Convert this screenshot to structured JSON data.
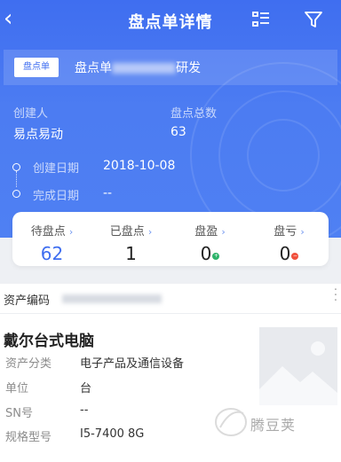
{
  "nav": {
    "back_icon": "‹",
    "title": "盘点单详情"
  },
  "order": {
    "tag": "盘点单",
    "name_prefix": "盘点单",
    "name_suffix": "研发"
  },
  "info": {
    "creator_label": "创建人",
    "creator_value": "易点易动",
    "total_label": "盘点总数",
    "total_value": "63",
    "created_label": "创建日期",
    "created_value": "2018-10-08",
    "finished_label": "完成日期",
    "finished_value": "--"
  },
  "stats": [
    {
      "label": "待盘点",
      "value": "62"
    },
    {
      "label": "已盘点",
      "value": "1"
    },
    {
      "label": "盘盈",
      "value": "0"
    },
    {
      "label": "盘亏",
      "value": "0"
    }
  ],
  "stat_arrow": "›",
  "badges": {
    "gain_symbol": "+",
    "loss_symbol": "−",
    "gain_color": "#2db36a",
    "loss_color": "#f0503c"
  },
  "asset": {
    "code_label": "资产编码",
    "name": "戴尔台式电脑",
    "fields": [
      {
        "label": "资产分类",
        "value": "电子产品及通信设备"
      },
      {
        "label": "单位",
        "value": "台"
      },
      {
        "label": "SN号",
        "value": "--"
      },
      {
        "label": "规格型号",
        "value": "I5-7400 8G"
      }
    ]
  },
  "watermark": "腾豆荚",
  "colors": {
    "primary": "#3f6ef0",
    "header_bg": "#4c7cf2"
  }
}
